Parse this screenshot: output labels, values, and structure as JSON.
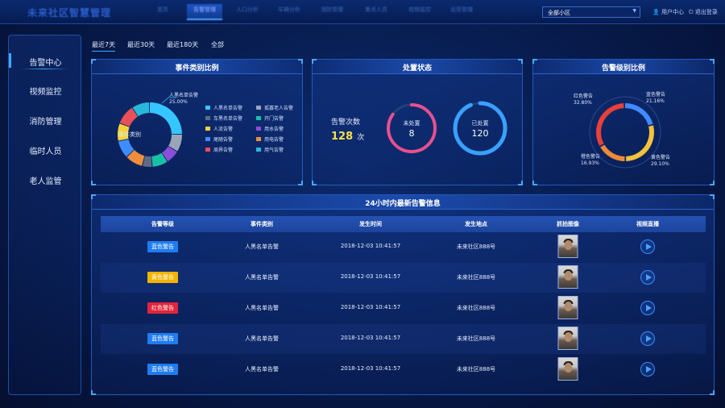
{
  "nav": {
    "logo": "未来社区智慧管理",
    "tabs": [
      "首页",
      "告警管理",
      "人口分析",
      "车辆分析",
      "消防管理",
      "重点人员",
      "视频监控",
      "运营管理"
    ],
    "active_tab_index": 1,
    "community_select": "全部小区",
    "user_center": "用户中心",
    "logout": "退出登录"
  },
  "sidebar": {
    "items": [
      {
        "label": "告警中心",
        "active": true
      },
      {
        "label": "视频监控"
      },
      {
        "label": "消防管理"
      },
      {
        "label": "临时人员"
      },
      {
        "label": "老人监管"
      }
    ]
  },
  "filters": {
    "items": [
      "最近7天",
      "最近30天",
      "最近180天",
      "全部"
    ],
    "active_index": 0
  },
  "event_category": {
    "title": "事件类别比例",
    "center_label": "事件类别",
    "callout_label": "人黑名单告警",
    "callout_value": "25.00%",
    "legend": [
      {
        "label": "人黑名单告警",
        "color": "#36c6ff"
      },
      {
        "label": "孤寡老人告警",
        "color": "#9aa6b8"
      },
      {
        "label": "车黑名单告警",
        "color": "#5b6b86"
      },
      {
        "label": "开门告警",
        "color": "#17c1a8"
      },
      {
        "label": "人流告警",
        "color": "#f3d33b"
      },
      {
        "label": "用水告警",
        "color": "#8a4fd8"
      },
      {
        "label": "尾随告警",
        "color": "#3f8cff"
      },
      {
        "label": "用电告警",
        "color": "#ef8e3d"
      },
      {
        "label": "周界告警",
        "color": "#e8505a"
      },
      {
        "label": "用气告警",
        "color": "#27b9d9"
      }
    ],
    "chart_data": {
      "type": "pie",
      "labels": [
        "人黑名单告警",
        "孤寡老人告警",
        "用水告警",
        "开门告警",
        "车黑名单告警",
        "用电告警",
        "尾随告警",
        "人流告警",
        "周界告警",
        "用气告警"
      ],
      "values": [
        25,
        9,
        7,
        8,
        5,
        9,
        9,
        9,
        10,
        9
      ],
      "colors": [
        "#36c6ff",
        "#9aa6b8",
        "#8a4fd8",
        "#17c1a8",
        "#5b6b86",
        "#ef8e3d",
        "#3f8cff",
        "#f3d33b",
        "#e8505a",
        "#27b9d9"
      ]
    }
  },
  "disposal": {
    "title": "处置状态",
    "alarm_count_label": "告警次数",
    "alarm_count": "128",
    "alarm_count_unit": "次",
    "unhandled_label": "未处置",
    "unhandled_value": "8",
    "unhandled_color": "#e8508f",
    "handled_label": "已处置",
    "handled_value": "120",
    "handled_color": "#3aa0ff"
  },
  "alarm_level": {
    "title": "告警级别比例",
    "chart_data": {
      "type": "pie",
      "labels": [
        "蓝色警告",
        "黄色警告",
        "橙色警告",
        "红色警告"
      ],
      "values": [
        21.16,
        29.1,
        16.93,
        32.8
      ],
      "colors": [
        "#3f8cff",
        "#f3c23b",
        "#f08a3a",
        "#e8403a"
      ]
    },
    "callouts": [
      {
        "label": "红色警告",
        "value": "32.80%"
      },
      {
        "label": "蓝色警告",
        "value": "21.16%"
      },
      {
        "label": "橙色警告",
        "value": "16.93%"
      },
      {
        "label": "黄色警告",
        "value": "29.10%"
      }
    ]
  },
  "alerts_table": {
    "title": "24小时内最新告警信息",
    "headers": [
      "告警等级",
      "事件类别",
      "发生时间",
      "发生地点",
      "抓拍图像",
      "视频直播"
    ],
    "rows": [
      {
        "level": "蓝色警告",
        "level_color": "#1f7cf2",
        "level_text_color": "#ffffff",
        "category": "人黑名单告警",
        "time": "2018-12-03 10:41:57",
        "place": "未来社区888号"
      },
      {
        "level": "黄色警告",
        "level_color": "#f5b400",
        "level_text_color": "#ffffff",
        "category": "人黑名单告警",
        "time": "2018-12-03 10:41:57",
        "place": "未来社区888号"
      },
      {
        "level": "红色警告",
        "level_color": "#e4243a",
        "level_text_color": "#ffffff",
        "category": "人黑名单告警",
        "time": "2018-12-03 10:41:57",
        "place": "未来社区888号"
      },
      {
        "level": "蓝色警告",
        "level_color": "#1f7cf2",
        "level_text_color": "#ffffff",
        "category": "人黑名单告警",
        "time": "2018-12-03 10:41:57",
        "place": "未来社区888号"
      },
      {
        "level": "蓝色警告",
        "level_color": "#1f7cf2",
        "level_text_color": "#ffffff",
        "category": "人黑名单告警",
        "time": "2018-12-03 10:41:57",
        "place": "未来社区888号"
      }
    ]
  }
}
